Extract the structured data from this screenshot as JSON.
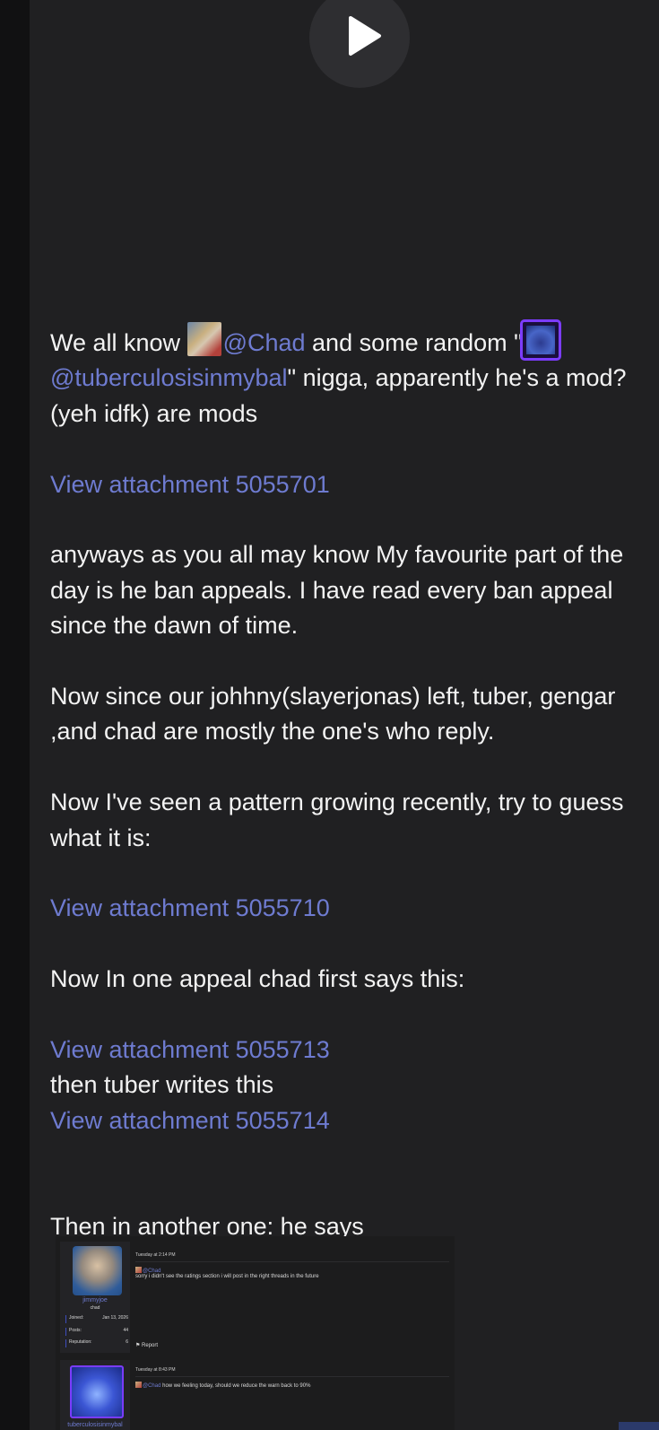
{
  "video": {
    "play_icon": "play-icon"
  },
  "post": {
    "line1_pre": "We all know ",
    "mention_chad": "@Chad",
    "line1_mid": " and some random \"",
    "mention_tuber": "@tuberculosisinmybal",
    "line1_post": "\" nigga, apparently he's a mod? (yeh idfk) are mods",
    "attachment1": "View attachment 5055701",
    "para2": "anyways as you all may know My favourite part of the day is he ban appeals. I have read every ban appeal since the dawn of time.",
    "para3": "Now since our johhny(slayerjonas) left, tuber, gengar ,and chad are mostly the one's who reply.",
    "para4": "Now I've seen a pattern growing recently, try to guess what it is:",
    "attachment2": "View attachment 5055710",
    "para5": "Now In one appeal chad first says this:",
    "attachment3": "View attachment 5055713",
    "para6": "then tuber writes this",
    "attachment4": "View attachment 5055714",
    "para7": "Then in another one: he says"
  },
  "embed": {
    "user1": {
      "name": "jimmyjoe",
      "title": "chad",
      "joined_label": "Joined:",
      "joined_value": "Jan 13, 2026",
      "posts_label": "Posts:",
      "posts_value": "44",
      "rep_label": "Reputation:",
      "rep_value": "6"
    },
    "msg1": {
      "timestamp": "Tuesday at 2:14 PM",
      "mention": "@Chad",
      "text": "sorry i didn't see the ratings section i will post in the right threads in the future",
      "report": "Report"
    },
    "msg2": {
      "timestamp": "Tuesday at 8:43 PM",
      "mention": "@Chad",
      "text": " how we feeling today, should we reduce the warn back to 90%"
    },
    "user2": {
      "name": "tuberculosisinmybal"
    }
  }
}
